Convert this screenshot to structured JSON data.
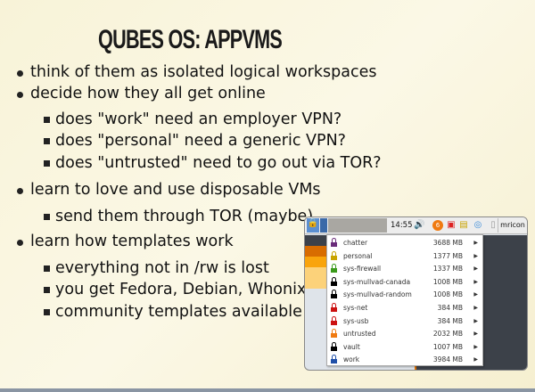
{
  "title": "QUBES OS: APPVMS",
  "bullets": [
    {
      "text": "think of them as isolated logical workspaces"
    },
    {
      "text": "decide how they all get online",
      "sub": [
        "does \"work\" need an employer VPN?",
        "does \"personal\" need a generic VPN?",
        "does \"untrusted\" need to go out via TOR?"
      ]
    },
    {
      "text": "learn to love and use disposable VMs",
      "sub": [
        "send them through TOR (maybe)"
      ]
    },
    {
      "text": "learn how templates work",
      "sub": [
        "everything not in /rw is lost",
        "you get Fedora, Debian, Whonix",
        "community templates available"
      ]
    }
  ],
  "screenshot": {
    "clock": "14:55",
    "user": "mricon",
    "notification_count": "6",
    "vms": [
      {
        "name": "chatter",
        "mem": "3688 MB",
        "color": "#6a2c7a"
      },
      {
        "name": "personal",
        "mem": "1377 MB",
        "color": "#c9a400"
      },
      {
        "name": "sys-firewall",
        "mem": "1337 MB",
        "color": "#3a9a1a"
      },
      {
        "name": "sys-mullvad-canada",
        "mem": "1008 MB",
        "color": "#000000"
      },
      {
        "name": "sys-mullvad-random",
        "mem": "1008 MB",
        "color": "#000000"
      },
      {
        "name": "sys-net",
        "mem": "384 MB",
        "color": "#cc1111"
      },
      {
        "name": "sys-usb",
        "mem": "384 MB",
        "color": "#cc1111"
      },
      {
        "name": "untrusted",
        "mem": "2032 MB",
        "color": "#f07a10"
      },
      {
        "name": "vault",
        "mem": "1007 MB",
        "color": "#000000"
      },
      {
        "name": "work",
        "mem": "3984 MB",
        "color": "#1f4fa8"
      }
    ]
  }
}
